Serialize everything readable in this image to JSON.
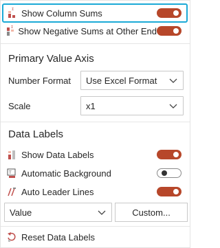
{
  "top_toggles": [
    {
      "label": "Show Column Sums",
      "icon": "column-sums-icon",
      "on": true
    },
    {
      "label": "Show Negative Sums at Other End",
      "icon": "negative-sums-icon",
      "on": true
    }
  ],
  "value_axis": {
    "title": "Primary Value Axis",
    "number_format_label": "Number Format",
    "number_format_value": "Use Excel Format",
    "scale_label": "Scale",
    "scale_value": "x1"
  },
  "data_labels": {
    "title": "Data Labels",
    "toggles": [
      {
        "label": "Show Data Labels",
        "icon": "data-labels-icon",
        "on": true
      },
      {
        "label": "Automatic Background",
        "icon": "background-icon",
        "on": false
      },
      {
        "label": "Auto Leader Lines",
        "icon": "leader-lines-icon",
        "on": true
      }
    ],
    "value_select": "Value",
    "custom_button": "Custom...",
    "reset_label": "Reset Data Labels"
  },
  "colors": {
    "accent_toggle": "#b7472a",
    "highlight": "#1aa9d6"
  }
}
